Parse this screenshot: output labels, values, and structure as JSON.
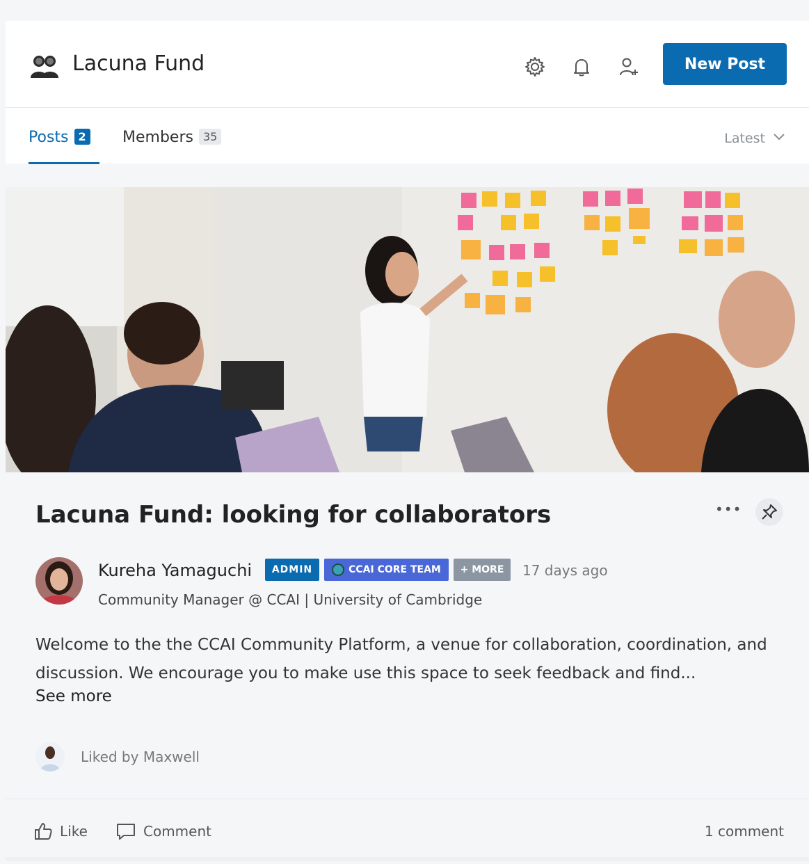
{
  "header": {
    "group_name": "Lacuna Fund",
    "new_post_label": "New Post"
  },
  "tabs": {
    "posts_label": "Posts",
    "posts_count": "2",
    "members_label": "Members",
    "members_count": "35",
    "sort_label": "Latest"
  },
  "post": {
    "title": "Lacuna Fund: looking for collaborators",
    "author": "Kureha Yamaguchi",
    "badges": {
      "admin": "ADMIN",
      "team": "CCAI CORE TEAM",
      "more": "+ MORE"
    },
    "time": "17 days ago",
    "role": "Community Manager @ CCAI | University of Cambridge",
    "body": "Welcome to the the CCAI Community Platform, a venue for collaboration, coordination, and discussion. We encourage you to make use this space to seek feedback and find...",
    "see_more": "See more",
    "liked_by": "Liked by Maxwell",
    "actions": {
      "like": "Like",
      "comment": "Comment"
    },
    "comments_count": "1 comment"
  },
  "colors": {
    "accent": "#0a6bb0",
    "badge_team": "#4a67d8",
    "badge_more": "#8c96a3"
  }
}
